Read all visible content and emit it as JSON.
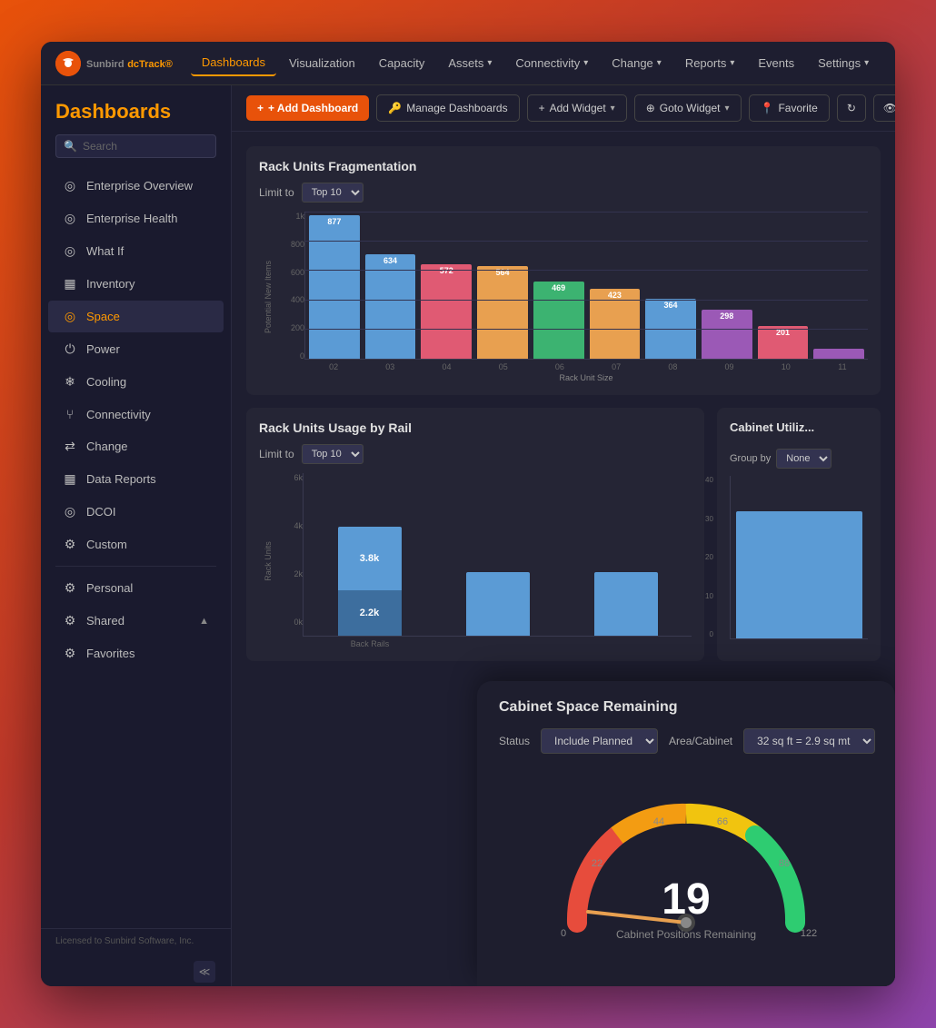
{
  "app": {
    "logo_text": "Sunbird",
    "logo_subtext": "dcTrack®",
    "logo_icon": "S"
  },
  "nav": {
    "items": [
      {
        "label": "Dashboards",
        "active": true,
        "has_dropdown": false
      },
      {
        "label": "Visualization",
        "active": false,
        "has_dropdown": false
      },
      {
        "label": "Capacity",
        "active": false,
        "has_dropdown": false
      },
      {
        "label": "Assets",
        "active": false,
        "has_dropdown": true
      },
      {
        "label": "Connectivity",
        "active": false,
        "has_dropdown": true
      },
      {
        "label": "Change",
        "active": false,
        "has_dropdown": true
      },
      {
        "label": "Reports",
        "active": false,
        "has_dropdown": true
      },
      {
        "label": "Events",
        "active": false,
        "has_dropdown": false
      },
      {
        "label": "Settings",
        "active": false,
        "has_dropdown": true
      }
    ]
  },
  "toolbar": {
    "add_dashboard": "+ Add Dashboard",
    "manage_dashboards": "Manage Dashboards",
    "add_widget": "+ Add Widget",
    "goto_widget": "Goto Widget",
    "favorite": "Favorite",
    "refresh_icon": "↻"
  },
  "sidebar": {
    "title": "Dashboards",
    "search_placeholder": "Search",
    "items": [
      {
        "label": "Enterprise Overview",
        "icon": "◎",
        "active": false
      },
      {
        "label": "Enterprise Health",
        "icon": "◎",
        "active": false
      },
      {
        "label": "What If",
        "icon": "◎",
        "active": false
      },
      {
        "label": "Inventory",
        "icon": "▦",
        "active": false
      },
      {
        "label": "Space",
        "icon": "◎",
        "active": true
      },
      {
        "label": "Power",
        "icon": "⏻",
        "active": false
      },
      {
        "label": "Cooling",
        "icon": "❄",
        "active": false
      },
      {
        "label": "Connectivity",
        "icon": "⑂",
        "active": false
      },
      {
        "label": "Change",
        "icon": "⇄",
        "active": false
      },
      {
        "label": "Data Reports",
        "icon": "▦",
        "active": false
      },
      {
        "label": "DCOI",
        "icon": "◎",
        "active": false
      },
      {
        "label": "Custom",
        "icon": "⚙",
        "active": false
      }
    ],
    "section_items": [
      {
        "label": "Personal",
        "icon": "⚙",
        "active": false
      },
      {
        "label": "Shared",
        "icon": "⚙",
        "active": false,
        "has_chevron": true
      },
      {
        "label": "Favorites",
        "icon": "⚙",
        "active": false
      }
    ],
    "footer_text": "Licensed to Sunbird Software, Inc."
  },
  "rack_frag_chart": {
    "title": "Rack Units Fragmentation",
    "limit_label": "Limit to",
    "limit_value": "Top 10",
    "y_axis_label": "Potential New Items",
    "x_axis_label": "Rack Unit Size",
    "y_ticks": [
      "1k",
      "800",
      "600",
      "400",
      "200",
      "0"
    ],
    "bars": [
      {
        "x": "02",
        "value": 877,
        "height_pct": 88,
        "color": "#5b9bd5"
      },
      {
        "x": "03",
        "value": 634,
        "height_pct": 64,
        "color": "#5b9bd5"
      },
      {
        "x": "04",
        "value": 572,
        "height_pct": 58,
        "color": "#e05a73"
      },
      {
        "x": "05",
        "value": 564,
        "height_pct": 57,
        "color": "#e8a050"
      },
      {
        "x": "06",
        "value": 469,
        "height_pct": 47,
        "color": "#3cb371"
      },
      {
        "x": "07",
        "value": 423,
        "height_pct": 43,
        "color": "#e8a050"
      },
      {
        "x": "08",
        "value": 364,
        "height_pct": 37,
        "color": "#5b9bd5"
      },
      {
        "x": "09",
        "value": 298,
        "height_pct": 30,
        "color": "#9b59b6"
      },
      {
        "x": "10",
        "value": 201,
        "height_pct": 20,
        "color": "#e05a73"
      },
      {
        "x": "11",
        "value": 60,
        "height_pct": 6,
        "color": "#9b59b6"
      }
    ]
  },
  "rack_usage_chart": {
    "title": "Rack Units Usage by Rail",
    "limit_label": "Limit to",
    "limit_value": "Top 10",
    "y_ticks": [
      "6k",
      "4k",
      "2k",
      "0k"
    ],
    "y_axis_label": "Rack Units",
    "bars": [
      {
        "x_label": "Back Rails",
        "top_value": "3.8k",
        "bottom_value": "2.2k",
        "top_color": "#5b9bd5",
        "bottom_color": "#3d6e9e",
        "top_h": 60,
        "bottom_h": 40
      },
      {
        "x_label": "",
        "top_value": "",
        "bottom_value": "",
        "top_color": "#5b9bd5",
        "bottom_color": "#3d6e9e",
        "top_h": 60,
        "bottom_h": 0
      },
      {
        "x_label": "",
        "top_value": "",
        "bottom_value": "",
        "top_color": "#5b9bd5",
        "bottom_color": "#3d6e9e",
        "top_h": 60,
        "bottom_h": 0
      }
    ]
  },
  "cabinet_util_chart": {
    "title": "Cabinet Utiliz...",
    "group_by_label": "Group by",
    "group_by_value": "None"
  },
  "gauge": {
    "title": "Cabinet Space Remaining",
    "status_label": "Status",
    "status_value": "Include Planned",
    "area_label": "Area/Cabinet",
    "area_value": "32 sq ft = 2.9 sq mt",
    "value": "19",
    "sub_label": "Cabinet Positions Remaining",
    "ticks": [
      "0",
      "22",
      "44",
      "66",
      "88",
      "122"
    ],
    "needle_angle": 195
  }
}
